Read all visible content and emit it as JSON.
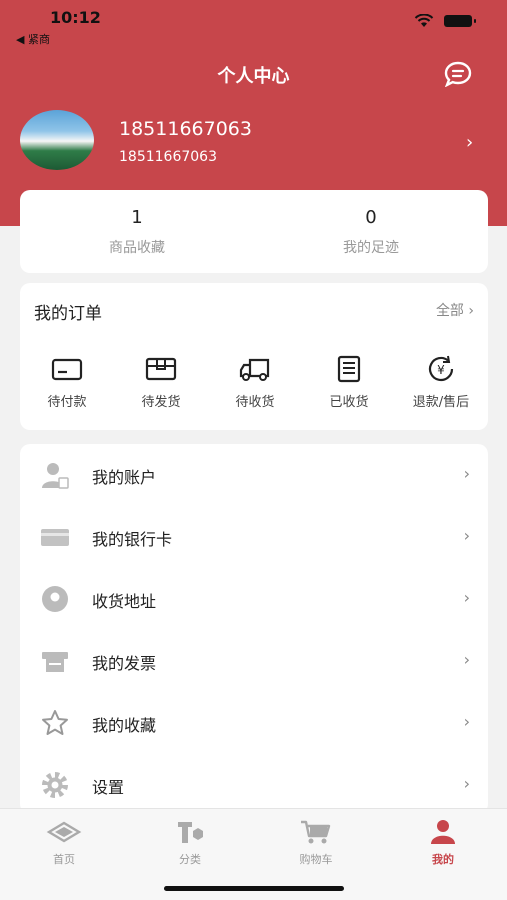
{
  "status_bar": {
    "time": "10:12",
    "back_label": "◀ 紧商"
  },
  "header": {
    "title": "个人中心"
  },
  "profile": {
    "name": "18511667063",
    "subtitle": "18511667063"
  },
  "stats": [
    {
      "value": "1",
      "label": "商品收藏"
    },
    {
      "value": "0",
      "label": "我的足迹"
    }
  ],
  "orders": {
    "title": "我的订单",
    "all_label": "全部",
    "items": [
      {
        "label": "待付款",
        "icon": "card-icon"
      },
      {
        "label": "待发货",
        "icon": "package-icon"
      },
      {
        "label": "待收货",
        "icon": "truck-icon"
      },
      {
        "label": "已收货",
        "icon": "receipt-icon"
      },
      {
        "label": "退款/售后",
        "icon": "refund-icon"
      }
    ]
  },
  "menu": [
    {
      "label": "我的账户",
      "icon": "account-icon"
    },
    {
      "label": "我的银行卡",
      "icon": "bank-card-icon"
    },
    {
      "label": "收货地址",
      "icon": "location-icon"
    },
    {
      "label": "我的发票",
      "icon": "invoice-icon"
    },
    {
      "label": "我的收藏",
      "icon": "star-icon"
    },
    {
      "label": "设置",
      "icon": "settings-icon"
    }
  ],
  "tabs": [
    {
      "label": "首页",
      "icon": "home-icon",
      "active": false
    },
    {
      "label": "分类",
      "icon": "category-icon",
      "active": false
    },
    {
      "label": "购物车",
      "icon": "cart-icon",
      "active": false
    },
    {
      "label": "我的",
      "icon": "user-icon",
      "active": true
    }
  ],
  "colors": {
    "brand": "#c7464b",
    "background": "#f2f2f2"
  }
}
